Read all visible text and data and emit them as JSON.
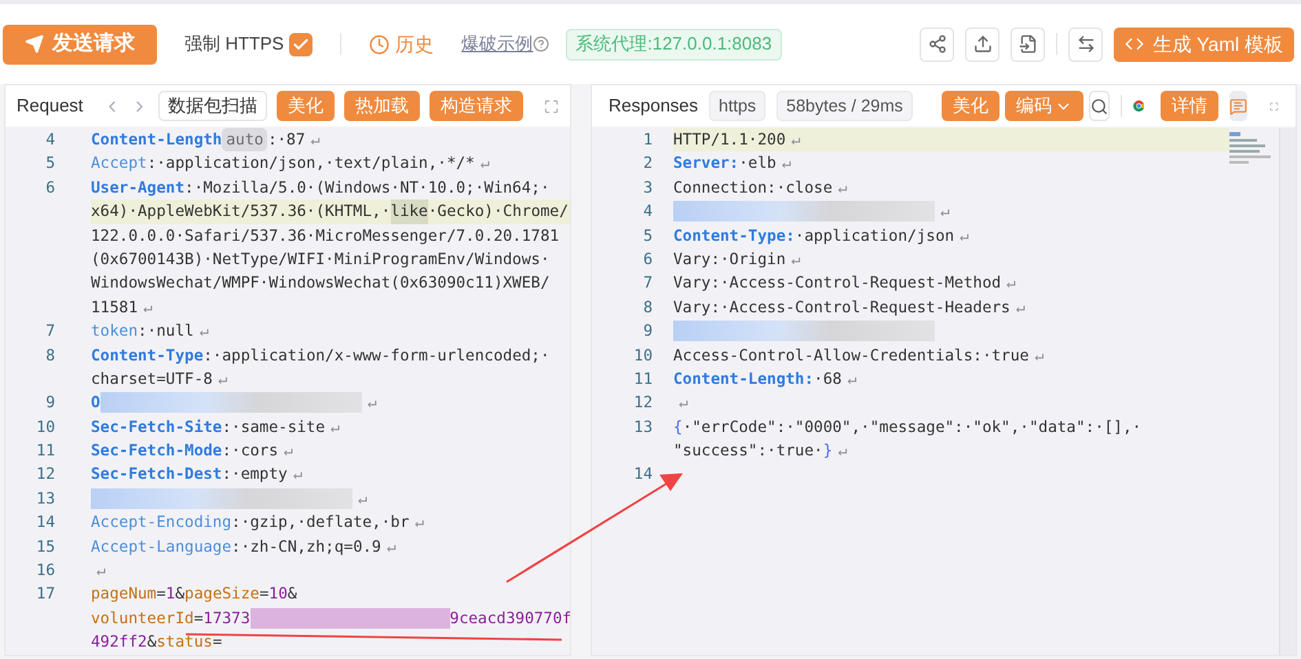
{
  "toolbar": {
    "send_button": "发送请求",
    "force_https": {
      "label": "强制 HTTPS",
      "checked": true
    },
    "history": "历史",
    "examples": "爆破示例",
    "proxy_badge": "系统代理:127.0.0.1:8083",
    "generate_button": "生成 Yaml 模板"
  },
  "request": {
    "title": "Request",
    "scan_button": "数据包扫描",
    "buttons": [
      "美化",
      "热加载",
      "构造请求"
    ],
    "lines": [
      {
        "num": "4",
        "rows": [
          {
            "kind": "plain",
            "parts": [
              {
                "kind": "key",
                "text": "Content-Length"
              },
              {
                "kind": "tag",
                "text": "auto"
              },
              {
                "kind": "text",
                "text": ":·87"
              },
              {
                "kind": "eol",
                "text": "↵"
              }
            ]
          }
        ]
      },
      {
        "num": "5",
        "rows": [
          {
            "kind": "plain",
            "parts": [
              {
                "kind": "hkey",
                "text": "Accept"
              },
              {
                "kind": "text",
                "text": ":·application/json,·text/plain,·*/*"
              },
              {
                "kind": "eol",
                "text": "↵"
              }
            ]
          }
        ]
      },
      {
        "num": "6",
        "rows": [
          {
            "kind": "plain",
            "parts": [
              {
                "kind": "key",
                "text": "User-Agent"
              },
              {
                "kind": "text",
                "text": ":·Mozilla/5.0·(Windows·NT·10.0;·Win64;·"
              }
            ]
          },
          {
            "kind": "highlighted",
            "parts": [
              {
                "kind": "text",
                "text": "x64)·AppleWebKit/537.36·(KHTML,·"
              },
              {
                "kind": "mark",
                "text": "like"
              },
              {
                "kind": "text",
                "text": "·Gecko)·Chrome/"
              }
            ]
          },
          {
            "kind": "plain",
            "parts": [
              {
                "kind": "text",
                "text": "122.0.0.0·Safari/537.36·MicroMessenger/7.0.20.1781"
              }
            ]
          },
          {
            "kind": "plain",
            "parts": [
              {
                "kind": "text",
                "text": "(0x6700143B)·NetType/WIFI·MiniProgramEnv/Windows·"
              }
            ]
          },
          {
            "kind": "plain",
            "parts": [
              {
                "kind": "text",
                "text": "WindowsWechat/WMPF·WindowsWechat(0x63090c11)XWEB/"
              }
            ]
          },
          {
            "kind": "plain",
            "parts": [
              {
                "kind": "text",
                "text": "11581"
              },
              {
                "kind": "eol",
                "text": "↵"
              }
            ]
          }
        ]
      },
      {
        "num": "7",
        "rows": [
          {
            "kind": "plain",
            "parts": [
              {
                "kind": "hkey",
                "text": "token"
              },
              {
                "kind": "text",
                "text": ":·null"
              },
              {
                "kind": "eol",
                "text": "↵"
              }
            ]
          }
        ]
      },
      {
        "num": "8",
        "rows": [
          {
            "kind": "plain",
            "parts": [
              {
                "kind": "key",
                "text": "Content-Type"
              },
              {
                "kind": "text",
                "text": ":·application/x-www-form-urlencoded;·"
              }
            ]
          },
          {
            "kind": "plain",
            "parts": [
              {
                "kind": "text",
                "text": "charset=UTF-8"
              },
              {
                "kind": "eol",
                "text": "↵"
              }
            ]
          }
        ]
      },
      {
        "num": "9",
        "rows": [
          {
            "kind": "plain",
            "parts": [
              {
                "kind": "key",
                "text": "O"
              },
              {
                "kind": "redacted"
              },
              {
                "kind": "eol",
                "text": "↵"
              }
            ]
          }
        ]
      },
      {
        "num": "10",
        "rows": [
          {
            "kind": "plain",
            "parts": [
              {
                "kind": "key",
                "text": "Sec-Fetch-Site"
              },
              {
                "kind": "text",
                "text": ":·same-site"
              },
              {
                "kind": "eol",
                "text": "↵"
              }
            ]
          }
        ]
      },
      {
        "num": "11",
        "rows": [
          {
            "kind": "plain",
            "parts": [
              {
                "kind": "key",
                "text": "Sec-Fetch-Mode"
              },
              {
                "kind": "text",
                "text": ":·cors"
              },
              {
                "kind": "eol",
                "text": "↵"
              }
            ]
          }
        ]
      },
      {
        "num": "12",
        "rows": [
          {
            "kind": "plain",
            "parts": [
              {
                "kind": "key",
                "text": "Sec-Fetch-Dest"
              },
              {
                "kind": "text",
                "text": ":·empty"
              },
              {
                "kind": "eol",
                "text": "↵"
              }
            ]
          }
        ]
      },
      {
        "num": "13",
        "rows": [
          {
            "kind": "plain",
            "parts": [
              {
                "kind": "redacted"
              },
              {
                "kind": "eol",
                "text": "↵"
              }
            ]
          }
        ]
      },
      {
        "num": "14",
        "rows": [
          {
            "kind": "plain",
            "parts": [
              {
                "kind": "hkey",
                "text": "Accept-Encoding"
              },
              {
                "kind": "text",
                "text": ":·gzip,·deflate,·br"
              },
              {
                "kind": "eol",
                "text": "↵"
              }
            ]
          }
        ]
      },
      {
        "num": "15",
        "rows": [
          {
            "kind": "plain",
            "parts": [
              {
                "kind": "hkey",
                "text": "Accept-Language"
              },
              {
                "kind": "text",
                "text": ":·zh-CN,zh;q=0.9"
              },
              {
                "kind": "eol",
                "text": "↵"
              }
            ]
          }
        ]
      },
      {
        "num": "16",
        "rows": [
          {
            "kind": "plain",
            "parts": [
              {
                "kind": "eol",
                "text": "↵"
              }
            ]
          }
        ]
      },
      {
        "num": "17",
        "rows": [
          {
            "kind": "plain",
            "parts": [
              {
                "kind": "param",
                "text": "pageNum"
              },
              {
                "kind": "text",
                "text": "="
              },
              {
                "kind": "pval",
                "text": "1"
              },
              {
                "kind": "text",
                "text": "&"
              },
              {
                "kind": "param",
                "text": "pageSize"
              },
              {
                "kind": "text",
                "text": "="
              },
              {
                "kind": "pval",
                "text": "10"
              },
              {
                "kind": "text",
                "text": "&"
              }
            ]
          },
          {
            "kind": "plain",
            "parts": [
              {
                "kind": "param",
                "text": "volunteerId"
              },
              {
                "kind": "text",
                "text": "="
              },
              {
                "kind": "pval",
                "text": "17373"
              },
              {
                "kind": "redacted_value"
              },
              {
                "kind": "pval",
                "text": "9ceacd390770f"
              }
            ]
          },
          {
            "kind": "plain",
            "parts": [
              {
                "kind": "pval",
                "text": "492ff2"
              },
              {
                "kind": "text",
                "text": "&"
              },
              {
                "kind": "param",
                "text": "status"
              },
              {
                "kind": "text",
                "text": "="
              }
            ]
          }
        ]
      }
    ]
  },
  "response": {
    "title": "Responses",
    "chips": [
      "https",
      "58bytes / 29ms"
    ],
    "beautify": "美化",
    "encode": "编码",
    "details": "详情",
    "lines": [
      {
        "num": "1",
        "rows": [
          {
            "kind": "highlighted",
            "parts": [
              {
                "kind": "text",
                "text": "HTTP/1.1·200"
              },
              {
                "kind": "eol",
                "text": "↵"
              }
            ]
          }
        ]
      },
      {
        "num": "2",
        "rows": [
          {
            "kind": "plain",
            "parts": [
              {
                "kind": "key",
                "text": "Server:"
              },
              {
                "kind": "text",
                "text": "·elb"
              },
              {
                "kind": "eol",
                "text": "↵"
              }
            ]
          }
        ]
      },
      {
        "num": "3",
        "rows": [
          {
            "kind": "plain",
            "parts": [
              {
                "kind": "text",
                "text": "Connection:·close"
              },
              {
                "kind": "eol",
                "text": "↵"
              }
            ]
          }
        ]
      },
      {
        "num": "4",
        "rows": [
          {
            "kind": "plain",
            "parts": [
              {
                "kind": "redacted"
              },
              {
                "kind": "eol",
                "text": "↵"
              }
            ]
          }
        ]
      },
      {
        "num": "5",
        "rows": [
          {
            "kind": "plain",
            "parts": [
              {
                "kind": "key",
                "text": "Content-Type:"
              },
              {
                "kind": "text",
                "text": "·application/json"
              },
              {
                "kind": "eol",
                "text": "↵"
              }
            ]
          }
        ]
      },
      {
        "num": "6",
        "rows": [
          {
            "kind": "plain",
            "parts": [
              {
                "kind": "text",
                "text": "Vary:·Origin"
              },
              {
                "kind": "eol",
                "text": "↵"
              }
            ]
          }
        ]
      },
      {
        "num": "7",
        "rows": [
          {
            "kind": "plain",
            "parts": [
              {
                "kind": "text",
                "text": "Vary:·Access-Control-Request-Method"
              },
              {
                "kind": "eol",
                "text": "↵"
              }
            ]
          }
        ]
      },
      {
        "num": "8",
        "rows": [
          {
            "kind": "plain",
            "parts": [
              {
                "kind": "text",
                "text": "Vary:·Access-Control-Request-Headers"
              },
              {
                "kind": "eol",
                "text": "↵"
              }
            ]
          }
        ]
      },
      {
        "num": "9",
        "rows": [
          {
            "kind": "plain",
            "parts": [
              {
                "kind": "redacted"
              }
            ]
          }
        ]
      },
      {
        "num": "10",
        "rows": [
          {
            "kind": "plain",
            "parts": [
              {
                "kind": "text",
                "text": "Access-Control-Allow-Credentials:·true"
              },
              {
                "kind": "eol",
                "text": "↵"
              }
            ]
          }
        ]
      },
      {
        "num": "11",
        "rows": [
          {
            "kind": "plain",
            "parts": [
              {
                "kind": "key",
                "text": "Content-Length:"
              },
              {
                "kind": "text",
                "text": "·68"
              },
              {
                "kind": "eol",
                "text": "↵"
              }
            ]
          }
        ]
      },
      {
        "num": "12",
        "rows": [
          {
            "kind": "plain",
            "parts": [
              {
                "kind": "eol",
                "text": "↵"
              }
            ]
          }
        ]
      },
      {
        "num": "13",
        "rows": [
          {
            "kind": "plain",
            "parts": [
              {
                "kind": "brace",
                "text": "{"
              },
              {
                "kind": "text",
                "text": "·\"errCode\":·\"0000\",·\"message\":·\"ok\",·\"data\":·[],·"
              }
            ]
          },
          {
            "kind": "plain",
            "parts": [
              {
                "kind": "text",
                "text": "\"success\":·true·"
              },
              {
                "kind": "brace",
                "text": "}"
              },
              {
                "kind": "eol",
                "text": "↵"
              }
            ]
          }
        ]
      },
      {
        "num": "14",
        "rows": [
          {
            "kind": "plain",
            "parts": []
          }
        ]
      }
    ]
  }
}
